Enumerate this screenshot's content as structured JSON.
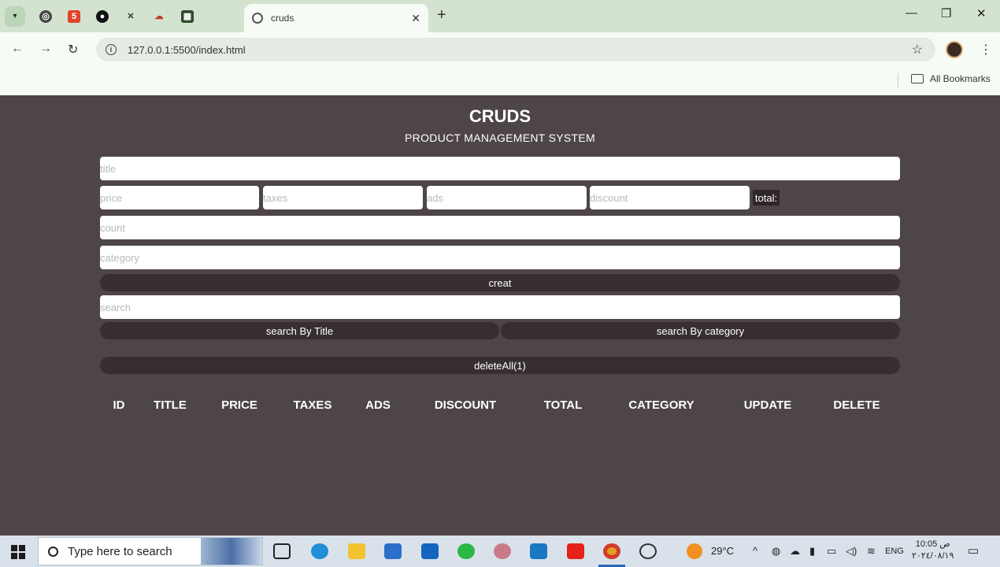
{
  "browser": {
    "tab_title": "cruds",
    "url": "127.0.0.1:5500/index.html",
    "bookmarks_label": "All Bookmarks"
  },
  "page": {
    "title": "CRUDS",
    "subtitle": "PRODUCT MANAGEMENT SYSTEM",
    "inputs": {
      "title": "title",
      "price": "price",
      "taxes": "taxes",
      "ads": "ads",
      "discount": "discount",
      "count": "count",
      "category": "category",
      "search": "search"
    },
    "total_label": "total:",
    "create_label": "creat",
    "search_title_label": "search By Title",
    "search_category_label": "search By category",
    "delete_all_label": "deleteAll(1)",
    "columns": [
      "ID",
      "TITLE",
      "PRICE",
      "TAXES",
      "ADS",
      "DISCOUNT",
      "TOTAL",
      "CATEGORY",
      "UPDATE",
      "DELETE"
    ]
  },
  "taskbar": {
    "search_placeholder": "Type here to search",
    "temperature": "29°C",
    "language": "ENG",
    "time": "10:05 ص",
    "date": "٢٠٢٤/٠٨/١٩"
  }
}
